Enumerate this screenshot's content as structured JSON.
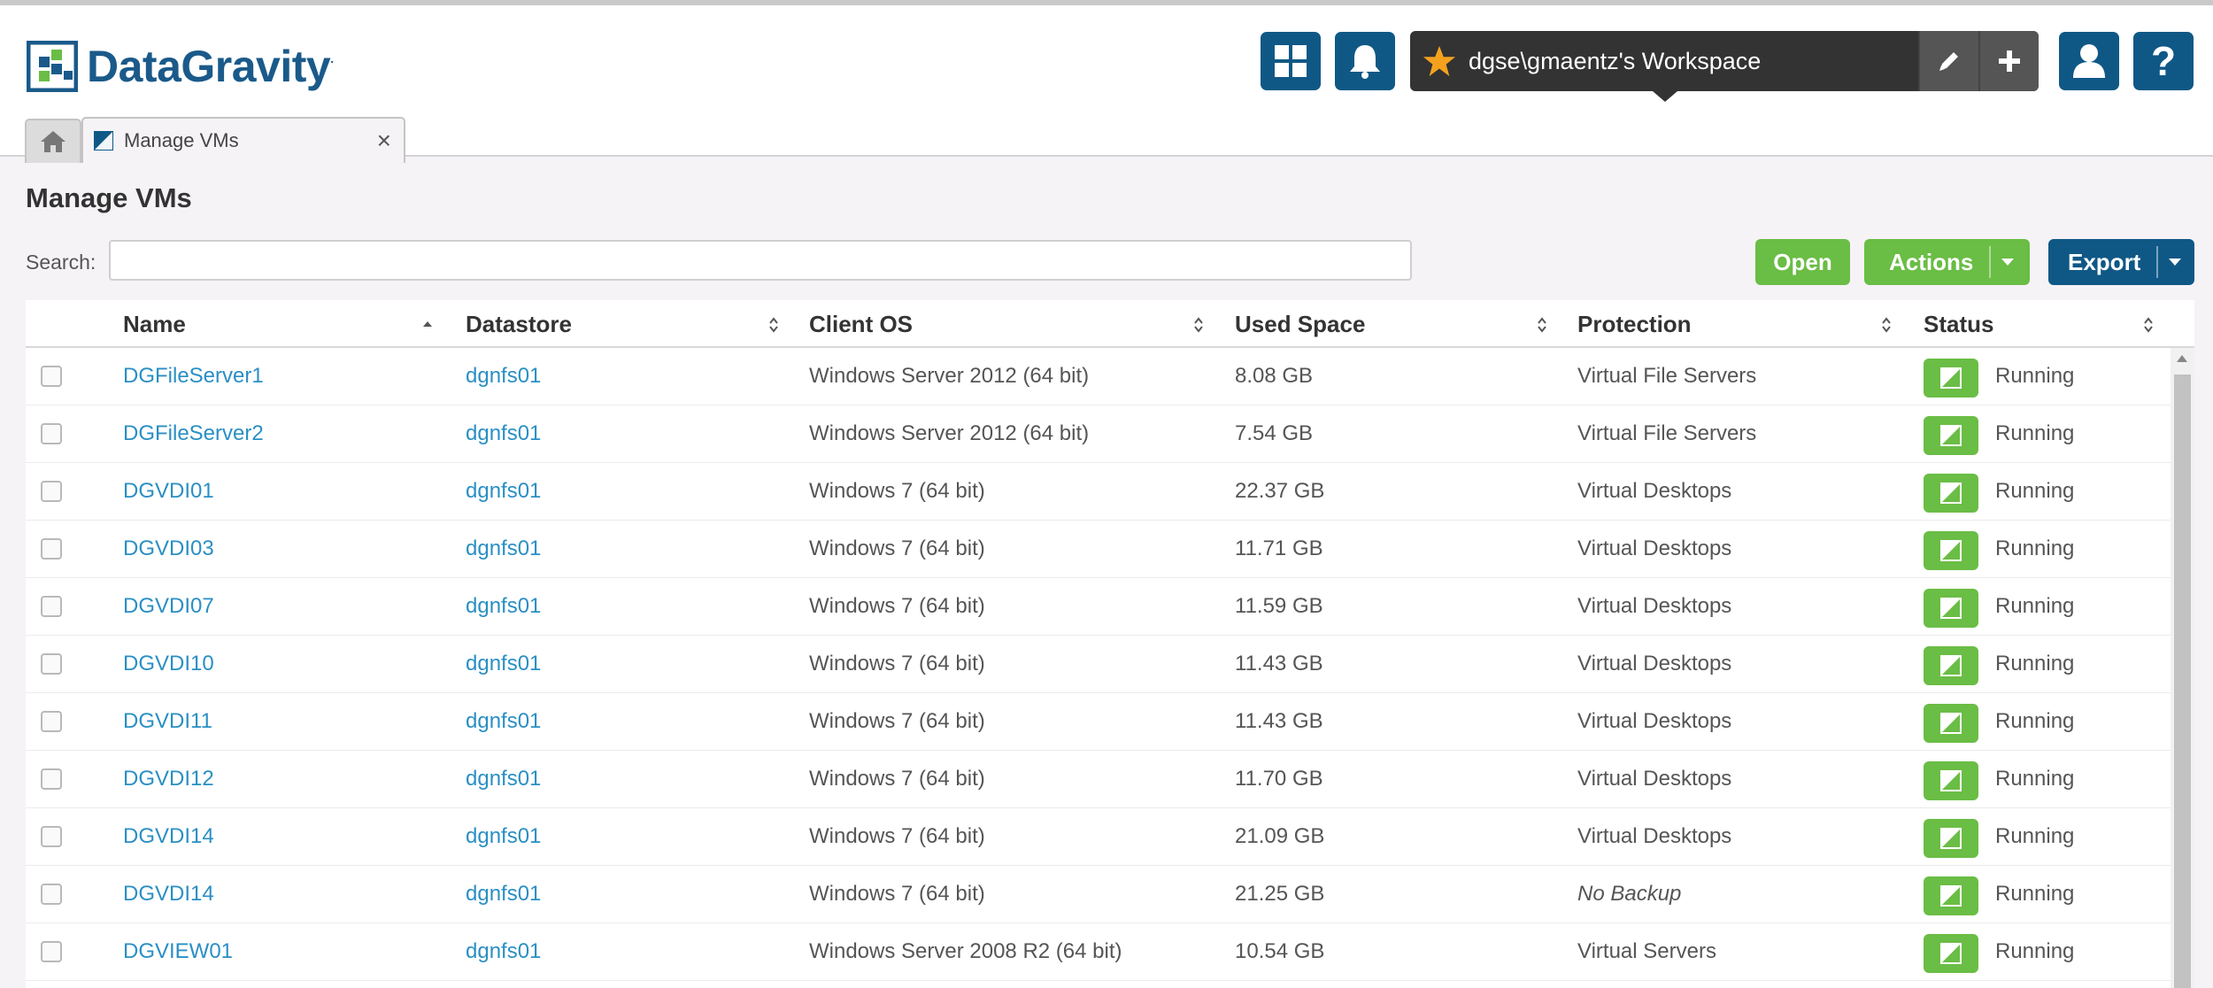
{
  "app": {
    "logo_text": "DataGravity",
    "logo_mark": "·"
  },
  "header": {
    "workspace_label": "dgse\\gmaentz's Workspace",
    "icons": [
      "dashboard-grid-icon",
      "bell-icon",
      "star-icon",
      "pencil-icon",
      "plus-icon",
      "user-icon",
      "help-icon"
    ],
    "help_glyph": "?"
  },
  "tabs": [
    {
      "label": "Manage VMs",
      "close": "×"
    }
  ],
  "page": {
    "title": "Manage VMs",
    "search_label": "Search:",
    "search_value": "",
    "open_label": "Open",
    "actions_label": "Actions",
    "export_label": "Export"
  },
  "table": {
    "columns": [
      "Name",
      "Datastore",
      "Client OS",
      "Used Space",
      "Protection",
      "Status"
    ],
    "sorted_column": "Name",
    "sort_direction": "ascending",
    "rows": [
      {
        "name": "DGFileServer1",
        "datastore": "dgnfs01",
        "os": "Windows Server 2012 (64 bit)",
        "used": "8.08 GB",
        "protection": "Virtual File Servers",
        "status": "Running"
      },
      {
        "name": "DGFileServer2",
        "datastore": "dgnfs01",
        "os": "Windows Server 2012 (64 bit)",
        "used": "7.54 GB",
        "protection": "Virtual File Servers",
        "status": "Running"
      },
      {
        "name": "DGVDI01",
        "datastore": "dgnfs01",
        "os": "Windows 7 (64 bit)",
        "used": "22.37 GB",
        "protection": "Virtual Desktops",
        "status": "Running"
      },
      {
        "name": "DGVDI03",
        "datastore": "dgnfs01",
        "os": "Windows 7 (64 bit)",
        "used": "11.71 GB",
        "protection": "Virtual Desktops",
        "status": "Running"
      },
      {
        "name": "DGVDI07",
        "datastore": "dgnfs01",
        "os": "Windows 7 (64 bit)",
        "used": "11.59 GB",
        "protection": "Virtual Desktops",
        "status": "Running"
      },
      {
        "name": "DGVDI10",
        "datastore": "dgnfs01",
        "os": "Windows 7 (64 bit)",
        "used": "11.43 GB",
        "protection": "Virtual Desktops",
        "status": "Running"
      },
      {
        "name": "DGVDI11",
        "datastore": "dgnfs01",
        "os": "Windows 7 (64 bit)",
        "used": "11.43 GB",
        "protection": "Virtual Desktops",
        "status": "Running"
      },
      {
        "name": "DGVDI12",
        "datastore": "dgnfs01",
        "os": "Windows 7 (64 bit)",
        "used": "11.70 GB",
        "protection": "Virtual Desktops",
        "status": "Running"
      },
      {
        "name": "DGVDI14",
        "datastore": "dgnfs01",
        "os": "Windows 7 (64 bit)",
        "used": "21.09 GB",
        "protection": "Virtual Desktops",
        "status": "Running"
      },
      {
        "name": "DGVDI14",
        "datastore": "dgnfs01",
        "os": "Windows 7 (64 bit)",
        "used": "21.25 GB",
        "protection": "No Backup",
        "status": "Running"
      },
      {
        "name": "DGVIEW01",
        "datastore": "dgnfs01",
        "os": "Windows Server 2008 R2 (64 bit)",
        "used": "10.54 GB",
        "protection": "Virtual Servers",
        "status": "Running"
      }
    ]
  },
  "colors": {
    "brand_blue": "#0f5886",
    "action_green": "#6abd45",
    "link_blue": "#2a8fc4",
    "workspace_dark": "#333333",
    "star_orange": "#f4a21e"
  }
}
